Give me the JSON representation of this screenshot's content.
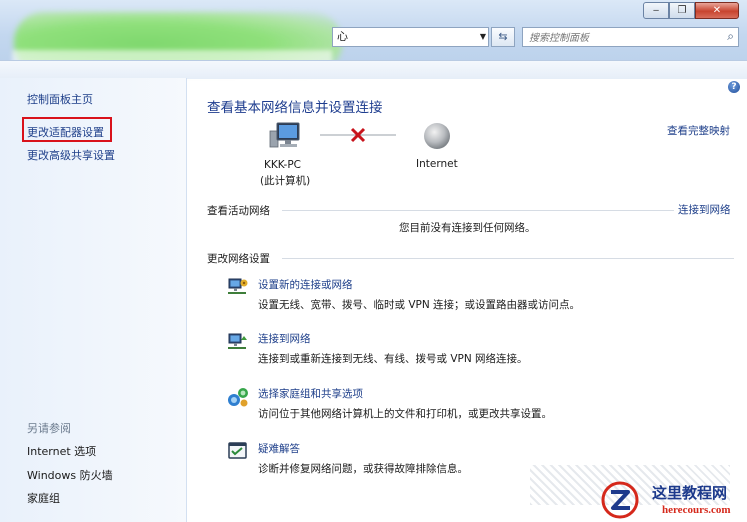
{
  "window": {
    "address_text": "心",
    "search_placeholder": "搜索控制面板"
  },
  "left_pane": {
    "home": "控制面板主页",
    "change_adapter": "更改适配器设置",
    "change_sharing": "更改高级共享设置",
    "see_also_title": "另请参阅",
    "see_also": [
      "Internet 选项",
      "Windows 防火墙",
      "家庭组"
    ]
  },
  "main": {
    "title": "查看基本网络信息并设置连接",
    "full_map_link": "查看完整映射",
    "computer_name": "KKK-PC",
    "computer_sub": "(此计算机)",
    "internet_label": "Internet",
    "active_networks_header": "查看活动网络",
    "connect_link": "连接到网络",
    "no_network_text": "您目前没有连接到任何网络。",
    "change_settings_header": "更改网络设置",
    "tasks": [
      {
        "title": "设置新的连接或网络",
        "desc": "设置无线、宽带、拨号、临时或 VPN 连接；或设置路由器或访问点。",
        "icon": "network-setup-icon"
      },
      {
        "title": "连接到网络",
        "desc": "连接到或重新连接到无线、有线、拨号或 VPN 网络连接。",
        "icon": "connect-network-icon"
      },
      {
        "title": "选择家庭组和共享选项",
        "desc": "访问位于其他网络计算机上的文件和打印机，或更改共享设置。",
        "icon": "homegroup-icon"
      },
      {
        "title": "疑难解答",
        "desc": "诊断并修复网络问题，或获得故障排除信息。",
        "icon": "troubleshoot-icon"
      }
    ]
  },
  "watermark": {
    "title": "这里教程网",
    "url": "herecours.com"
  },
  "colors": {
    "link": "#1e3f8a",
    "title": "#1e3d8f",
    "highlight_box": "#d9121b",
    "no_connection_x": "#c8141c"
  }
}
